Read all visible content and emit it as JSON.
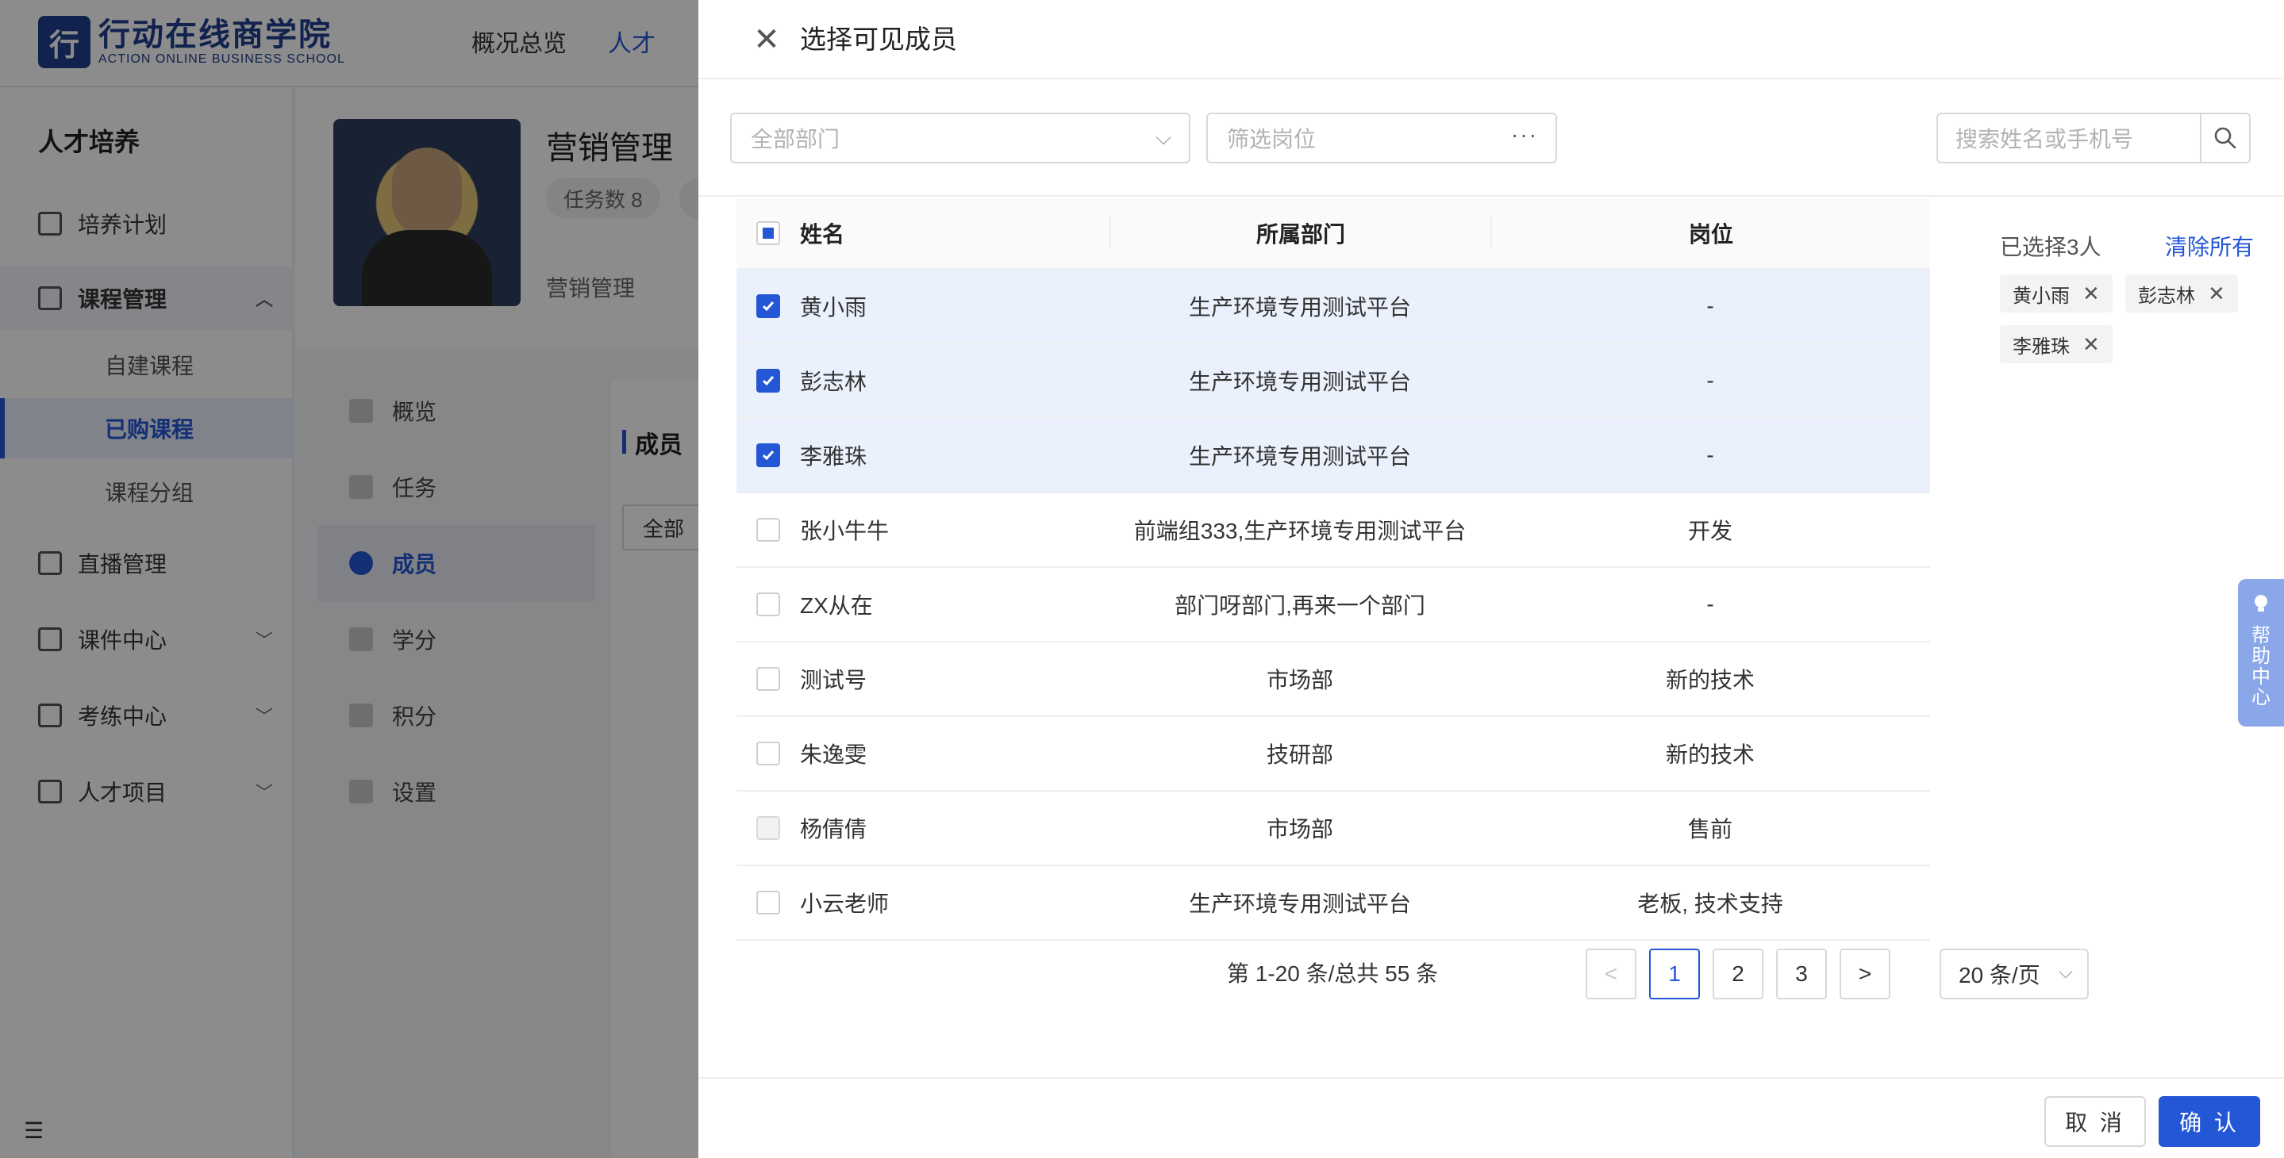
{
  "app": {
    "logo": {
      "cn": "行动在线商学院",
      "en": "ACTION ONLINE BUSINESS SCHOOL",
      "mark": "行"
    },
    "topnav": [
      "概况总览",
      "人才"
    ],
    "sidebar": {
      "title": "人才培养",
      "items": [
        {
          "label": "培养计划",
          "icon": "calendar-icon"
        },
        {
          "label": "课程管理",
          "icon": "book-icon"
        },
        {
          "label": "直播管理",
          "icon": "video-icon"
        },
        {
          "label": "课件中心",
          "icon": "courseware-icon"
        },
        {
          "label": "考练中心",
          "icon": "exam-icon"
        },
        {
          "label": "人才项目",
          "icon": "project-icon"
        }
      ],
      "subitems": [
        "自建课程",
        "已购课程",
        "课程分组"
      ],
      "chevron_up": "︿",
      "chevron_down": "﹀",
      "collapse_glyph": "☰"
    },
    "profile": {
      "name": "营销管理",
      "badge": "任务数 8",
      "desc": "营销管理"
    },
    "course_menu": [
      "概览",
      "任务",
      "成员",
      "学分",
      "积分",
      "设置"
    ],
    "right_panel": {
      "title": "成员",
      "select": "全部"
    }
  },
  "drawer": {
    "close_glyph": "✕",
    "title": "选择可见成员",
    "filters": {
      "dept_placeholder": "全部部门",
      "dept_arrow": "⌵",
      "position_placeholder": "筛选岗位",
      "position_dots": "···",
      "search_placeholder": "搜索姓名或手机号"
    },
    "table": {
      "headers": {
        "name": "姓名",
        "dept": "所属部门",
        "position": "岗位"
      },
      "rows": [
        {
          "name": "黄小雨",
          "dept": "生产环境专用测试平台",
          "position": "-",
          "checked": true
        },
        {
          "name": "彭志林",
          "dept": "生产环境专用测试平台",
          "position": "-",
          "checked": true
        },
        {
          "name": "李雅珠",
          "dept": "生产环境专用测试平台",
          "position": "-",
          "checked": true
        },
        {
          "name": "张小牛牛",
          "dept": "前端组333,生产环境专用测试平台",
          "position": "开发",
          "checked": false
        },
        {
          "name": "ZX从在",
          "dept": "部门呀部门,再来一个部门",
          "position": "-",
          "checked": false
        },
        {
          "name": "测试号",
          "dept": "市场部",
          "position": "新的技术",
          "checked": false
        },
        {
          "name": "朱逸雯",
          "dept": "技研部",
          "position": "新的技术",
          "checked": false
        },
        {
          "name": "杨倩倩",
          "dept": "市场部",
          "position": "售前",
          "checked": false,
          "disabled": true
        },
        {
          "name": "小云老师",
          "dept": "生产环境专用测试平台",
          "position": "老板, 技术支持",
          "checked": false
        }
      ]
    },
    "pagination": {
      "total_text": "第 1-20 条/总共 55 条",
      "prev": "<",
      "next": ">",
      "pages": [
        "1",
        "2",
        "3"
      ],
      "current": "1",
      "page_size": "20 条/页"
    },
    "selected": {
      "count_text": "已选择3人",
      "clear_label": "清除所有",
      "tags": [
        "黄小雨",
        "彭志林",
        "李雅珠"
      ],
      "tag_close": "✕"
    },
    "help": {
      "label": "帮助中心",
      "icon": "lightbulb-icon"
    },
    "footer": {
      "cancel": "取 消",
      "confirm": "确 认"
    },
    "colors": {
      "primary": "#2457d6",
      "selected_row": "#eaf1fd",
      "help_tab": "#8aa7ea"
    }
  }
}
